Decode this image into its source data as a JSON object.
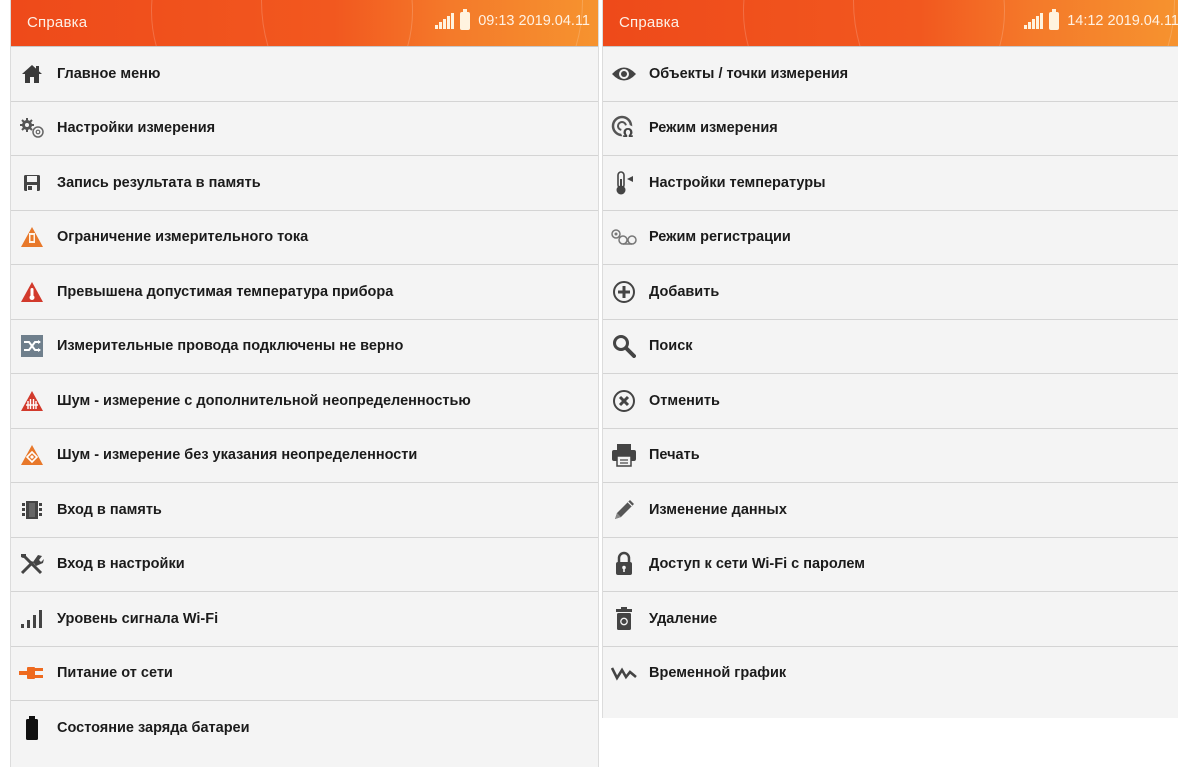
{
  "left": {
    "title": "Справка",
    "clock": "09:13 2019.04.11",
    "items": [
      {
        "label": "Главное меню",
        "icon": "home-icon"
      },
      {
        "label": "Настройки измерения",
        "icon": "gears-icon"
      },
      {
        "label": "Запись результата в память",
        "icon": "floppy-disk-icon"
      },
      {
        "label": "Ограничение измерительного тока",
        "icon": "current-limit-warning-icon"
      },
      {
        "label": "Превышена допустимая температура прибора",
        "icon": "temperature-warning-icon"
      },
      {
        "label": "Измерительные провода подключены не верно",
        "icon": "crossed-wires-icon"
      },
      {
        "label": "Шум - измерение с дополнительной неопределенностью",
        "icon": "noise-warning-red-icon"
      },
      {
        "label": "Шум - измерение без указания неопределенности",
        "icon": "noise-warning-orange-icon"
      },
      {
        "label": "Вход в память",
        "icon": "memory-icon"
      },
      {
        "label": "Вход в настройки",
        "icon": "tools-icon"
      },
      {
        "label": "Уровень сигнала Wi-Fi",
        "icon": "signal-bars-icon"
      },
      {
        "label": "Питание от сети",
        "icon": "mains-plug-icon"
      },
      {
        "label": "Состояние заряда батареи",
        "icon": "battery-icon"
      }
    ]
  },
  "right": {
    "title": "Справка",
    "clock": "14:12 2019.04.11",
    "items": [
      {
        "label": "Объекты / точки измерения",
        "icon": "eye-icon"
      },
      {
        "label": "Режим измерения",
        "icon": "measurement-mode-icon"
      },
      {
        "label": "Настройки температуры",
        "icon": "thermometer-icon"
      },
      {
        "label": "Режим регистрации",
        "icon": "recording-mode-icon"
      },
      {
        "label": "Добавить",
        "icon": "add-circle-icon"
      },
      {
        "label": "Поиск",
        "icon": "search-icon"
      },
      {
        "label": "Отменить",
        "icon": "cancel-circle-icon"
      },
      {
        "label": "Печать",
        "icon": "printer-icon"
      },
      {
        "label": "Изменение данных",
        "icon": "pencil-icon"
      },
      {
        "label": "Доступ к сети Wi-Fi с паролем",
        "icon": "lock-icon"
      },
      {
        "label": "Удаление",
        "icon": "trash-icon"
      },
      {
        "label": "Временной график",
        "icon": "time-graph-icon"
      }
    ]
  },
  "colors": {
    "titlebar": "#f2581f",
    "warning_red": "#d23a2c",
    "warning_orange": "#e8782a",
    "icon_gray": "#444444"
  }
}
